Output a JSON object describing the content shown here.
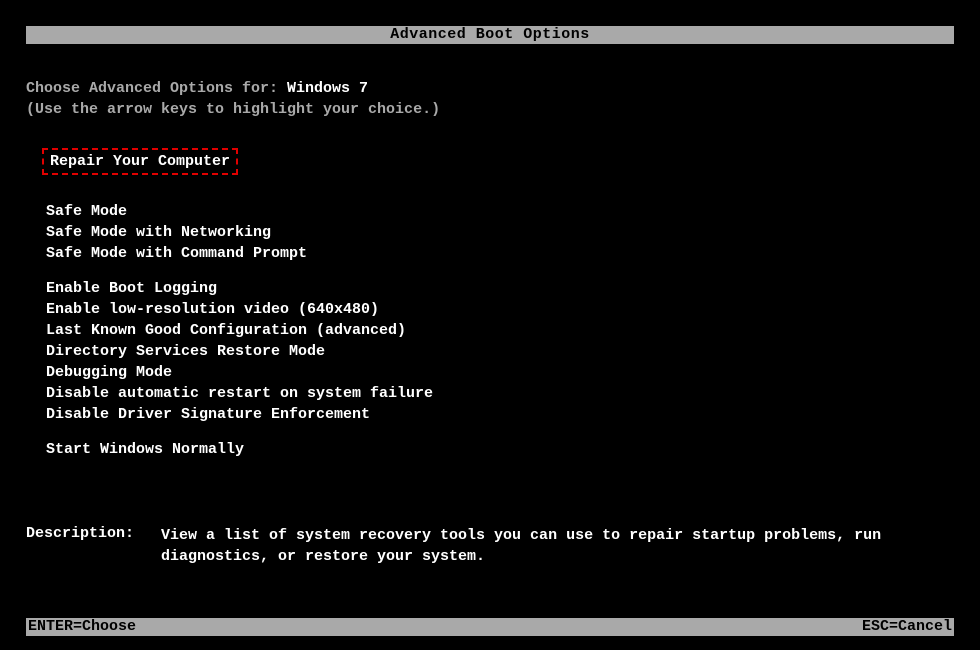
{
  "title": "Advanced Boot Options",
  "prompt": {
    "label": "Choose Advanced Options for: ",
    "os": "Windows 7"
  },
  "hint": "(Use the arrow keys to highlight your choice.)",
  "selected": "Repair Your Computer",
  "groups": [
    {
      "items": [
        "Safe Mode",
        "Safe Mode with Networking",
        "Safe Mode with Command Prompt"
      ]
    },
    {
      "items": [
        "Enable Boot Logging",
        "Enable low-resolution video (640x480)",
        "Last Known Good Configuration (advanced)",
        "Directory Services Restore Mode",
        "Debugging Mode",
        "Disable automatic restart on system failure",
        "Disable Driver Signature Enforcement"
      ]
    },
    {
      "items": [
        "Start Windows Normally"
      ]
    }
  ],
  "description": {
    "label": "Description:",
    "text": "View a list of system recovery tools you can use to repair startup problems, run diagnostics, or restore your system."
  },
  "footer": {
    "enter": "ENTER=Choose",
    "esc": "ESC=Cancel"
  }
}
